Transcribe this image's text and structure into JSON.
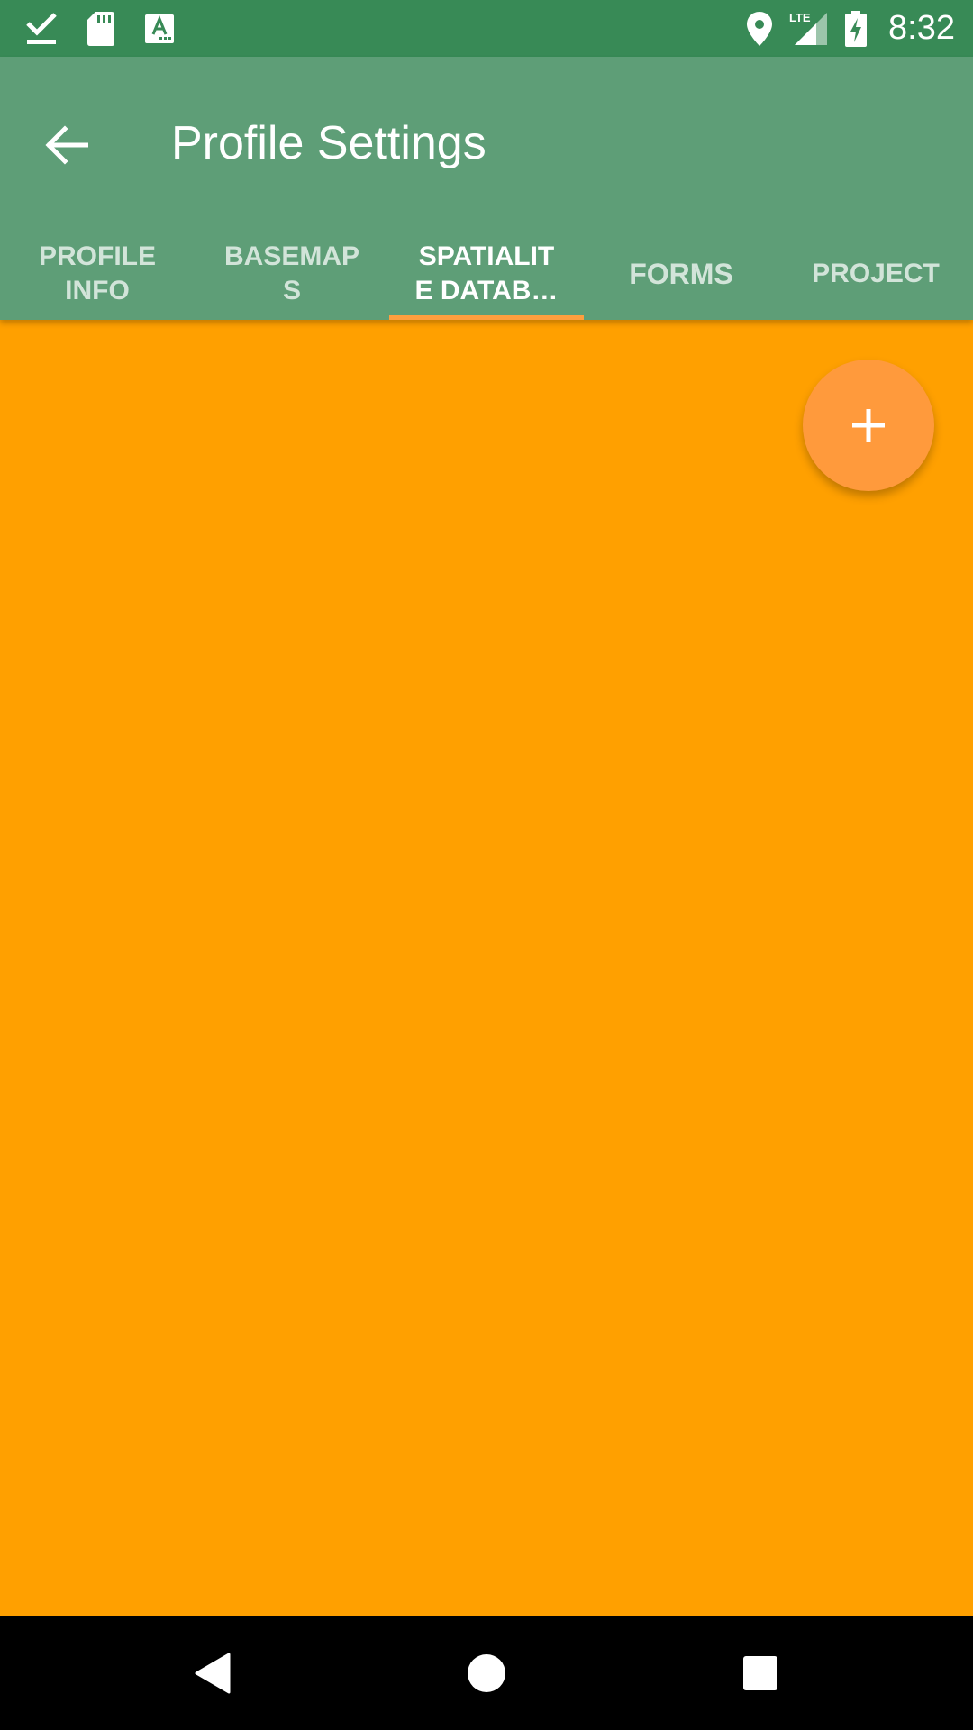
{
  "status_bar": {
    "time": "8:32",
    "left_icons": [
      "download-done-icon",
      "sd-card-icon",
      "keyboard-a-icon"
    ],
    "right_icons": [
      "location-pin-icon",
      "lte-signal-icon",
      "battery-charging-icon"
    ],
    "network_label": "LTE",
    "background": "#388a56"
  },
  "app_bar": {
    "title": "Profile Settings",
    "background": "#5e9e77"
  },
  "tabs": [
    {
      "label": "PROFILE\nINFO",
      "active": false
    },
    {
      "label": "BASEMAP\nS",
      "active": false
    },
    {
      "label": "SPATIALIT\nE DATAB…",
      "active": true
    },
    {
      "label": "FORMS",
      "active": false
    },
    {
      "label": "PROJECT",
      "active": false
    }
  ],
  "content": {
    "background": "#ffa000"
  },
  "fab": {
    "icon": "plus-icon",
    "color": "#ff9a3c"
  },
  "nav_bar": {
    "buttons": [
      "back-triangle-icon",
      "home-circle-icon",
      "recents-square-icon"
    ]
  }
}
